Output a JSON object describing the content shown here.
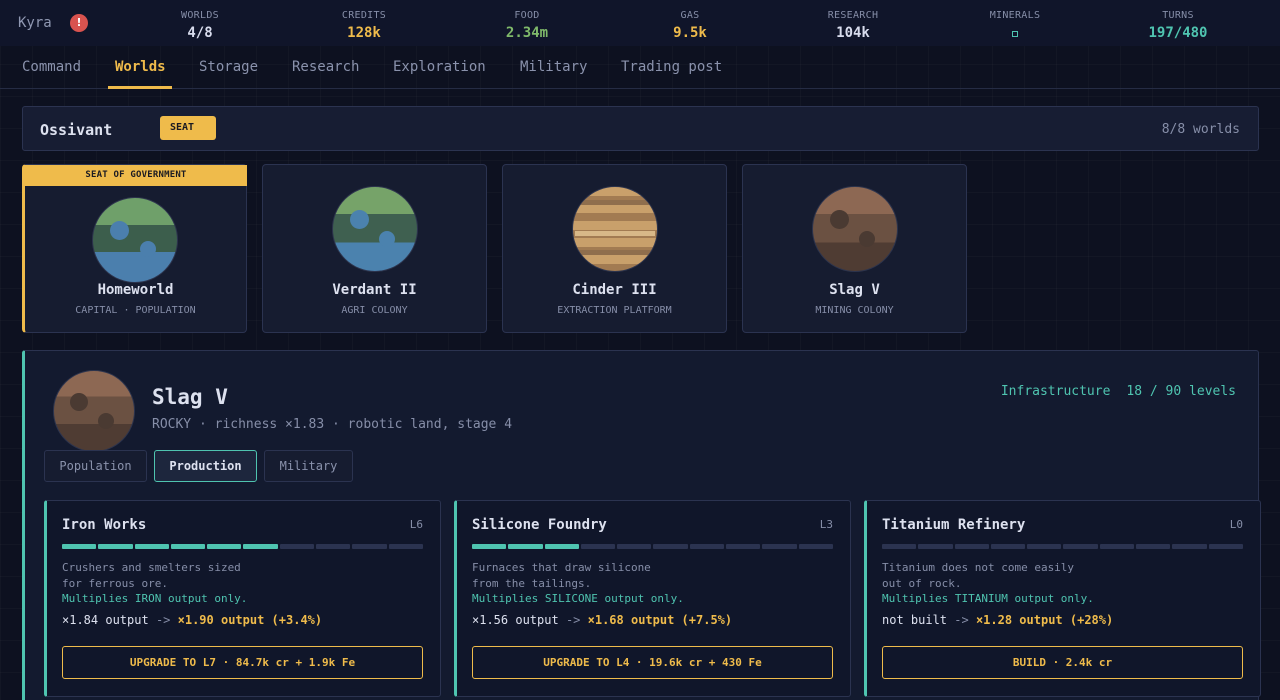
{
  "topbar": {
    "player": "Kyra",
    "alert": "!",
    "stats": [
      {
        "label": "WORLDS",
        "value": "4/8",
        "color": "#d8dced"
      },
      {
        "label": "CREDITS",
        "value": "128k",
        "color": "#efbb4b"
      },
      {
        "label": "FOOD",
        "value": "2.34m",
        "color": "#7fb96a"
      },
      {
        "label": "GAS",
        "value": "9.5k",
        "color": "#efbb4b"
      },
      {
        "label": "RESEARCH",
        "value": "104k",
        "color": "#d8dced"
      },
      {
        "label": "MINERALS",
        "icon": "mineral-icon",
        "color": "#4fc4b0"
      },
      {
        "label": "TURNS",
        "value": "197/480",
        "color": "#4fc4b0"
      }
    ]
  },
  "nav": {
    "tabs": [
      "Command",
      "Worlds",
      "Storage",
      "Research",
      "Exploration",
      "Military",
      "Trading post"
    ],
    "active": "Worlds"
  },
  "system": {
    "name": "Ossivant",
    "badge": "SEAT",
    "count": "8/8 worlds"
  },
  "worlds": [
    {
      "name": "Homeworld",
      "type": "CAPITAL · POPULATION",
      "banner": "SEAT OF GOVERNMENT",
      "planet": "home-planet-icon"
    },
    {
      "name": "Verdant II",
      "type": "AGRI COLONY",
      "planet": "verdant-planet-icon"
    },
    {
      "name": "Cinder III",
      "type": "EXTRACTION PLATFORM",
      "planet": "cinder-planet-icon"
    },
    {
      "name": "Slag V",
      "type": "MINING COLONY",
      "planet": "slag-planet-icon"
    }
  ],
  "detail": {
    "name": "Slag V",
    "desc": "ROCKY · richness ×1.83 · robotic land, stage 4",
    "infra_label": "Infrastructure",
    "infra_value": "18 / 90 levels",
    "tabs": [
      "Population",
      "Production",
      "Military"
    ],
    "active_tab": "Production"
  },
  "buildings": [
    {
      "name": "Iron Works",
      "level": "L6",
      "filled": 6,
      "total": 10,
      "desc1": "Crushers and smelters sized",
      "desc2": "for ferrous ore.",
      "multiplier": "Multiplies IRON output only.",
      "current": "×1.84 output",
      "arrow": "->",
      "next": "×1.90 output (+3.4%)",
      "button": "UPGRADE TO L7 · 84.7k cr + 1.9k Fe"
    },
    {
      "name": "Silicone Foundry",
      "level": "L3",
      "filled": 3,
      "total": 10,
      "desc1": "Furnaces that draw silicone",
      "desc2": "from the tailings.",
      "multiplier": "Multiplies SILICONE output only.",
      "current": "×1.56 output",
      "arrow": "->",
      "next": "×1.68 output (+7.5%)",
      "button": "UPGRADE TO L4 · 19.6k cr + 430 Fe"
    },
    {
      "name": "Titanium Refinery",
      "level": "L0",
      "filled": 0,
      "total": 10,
      "desc1": "Titanium does not come easily",
      "desc2": "out of rock.",
      "multiplier": "Multiplies TITANIUM output only.",
      "current": "not built",
      "arrow": "->",
      "next": "×1.28 output (+28%)",
      "button": "BUILD · 2.4k cr"
    }
  ]
}
